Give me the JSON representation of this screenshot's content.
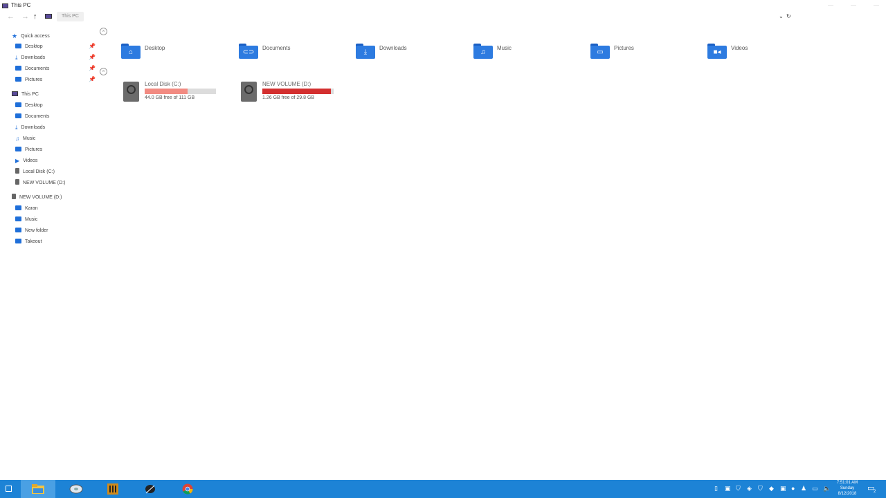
{
  "window": {
    "title": "This PC"
  },
  "address": {
    "crumb": "This PC"
  },
  "sidebar": {
    "quick_access": "Quick access",
    "quick_items": [
      {
        "label": "Desktop",
        "icon": "folder-icon"
      },
      {
        "label": "Downloads",
        "icon": "download-icon"
      },
      {
        "label": "Documents",
        "icon": "folder-icon"
      },
      {
        "label": "Pictures",
        "icon": "pictures-icon"
      }
    ],
    "this_pc": "This PC",
    "pc_items": [
      {
        "label": "Desktop"
      },
      {
        "label": "Documents"
      },
      {
        "label": "Downloads"
      },
      {
        "label": "Music"
      },
      {
        "label": "Pictures"
      },
      {
        "label": "Videos"
      },
      {
        "label": "Local Disk (C:)"
      },
      {
        "label": "NEW VOLUME (D:)"
      }
    ],
    "volume": "NEW VOLUME (D:)",
    "volume_items": [
      {
        "label": "Karan"
      },
      {
        "label": "Music"
      },
      {
        "label": "New folder"
      },
      {
        "label": "Takeout"
      }
    ]
  },
  "folders": [
    {
      "label": "Desktop",
      "icon": "home-icon"
    },
    {
      "label": "Documents",
      "icon": "link-icon"
    },
    {
      "label": "Downloads",
      "icon": "download-icon"
    },
    {
      "label": "Music",
      "icon": "music-icon"
    },
    {
      "label": "Pictures",
      "icon": "image-icon"
    },
    {
      "label": "Videos",
      "icon": "video-icon"
    }
  ],
  "drives": [
    {
      "name": "Local Disk (C:)",
      "free": "44.0 GB free of 111 GB",
      "used_fraction": 0.6,
      "color": "#f28b82"
    },
    {
      "name": "NEW VOLUME (D:)",
      "free": "1.26 GB free of 29.8 GB",
      "used_fraction": 0.96,
      "color": "#d32f2f"
    }
  ],
  "taskbar": {
    "clock": {
      "time": "7:51:01 AM",
      "day": "Sunday",
      "date": "8/12/2018"
    },
    "notifications": "2",
    "accent": "#1d83d6"
  }
}
